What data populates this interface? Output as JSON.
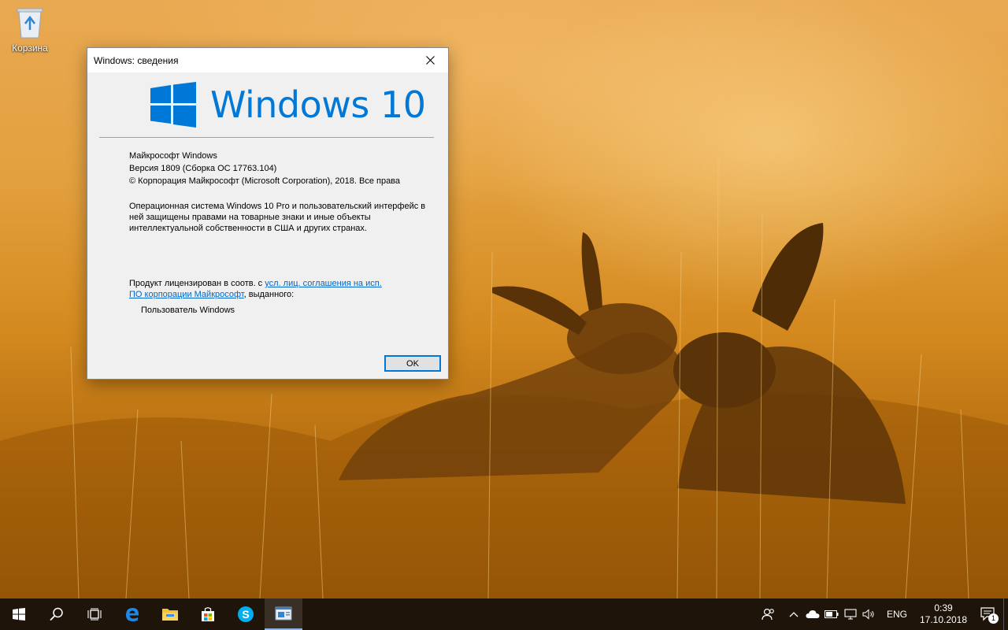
{
  "desktop": {
    "icons": [
      {
        "label": "Корзина",
        "icon": "recycle-bin-icon"
      }
    ]
  },
  "dialog": {
    "title": "Windows: сведения",
    "logo_text": "Windows 10",
    "line1": "Майкрософт Windows",
    "line2": "Версия 1809 (Сборка ОС 17763.104)",
    "line3": "© Корпорация Майкрософт (Microsoft Corporation), 2018. Все права",
    "description": "Операционная система Windows 10 Pro и пользовательский интерфейс в ней защищены правами на товарные знаки и иные объекты интеллектуальной собственности в США и других странах.",
    "license_prefix": "Продукт лицензирован в соотв. с ",
    "license_link": "усл. лиц. соглашения на исп. ПО корпорации Майкрософт",
    "license_suffix": ", выданного:",
    "licensed_user": "Пользователь Windows",
    "ok_label": "OK"
  },
  "taskbar": {
    "buttons": [
      "start-icon",
      "search-icon",
      "task-view-icon",
      "edge-icon",
      "file-explorer-icon",
      "store-icon",
      "skype-icon",
      "winver-icon"
    ],
    "active": "winver-icon",
    "language": "ENG",
    "time": "0:39",
    "date": "17.10.2018",
    "notification_count": "1",
    "accent": "#0078d7"
  }
}
